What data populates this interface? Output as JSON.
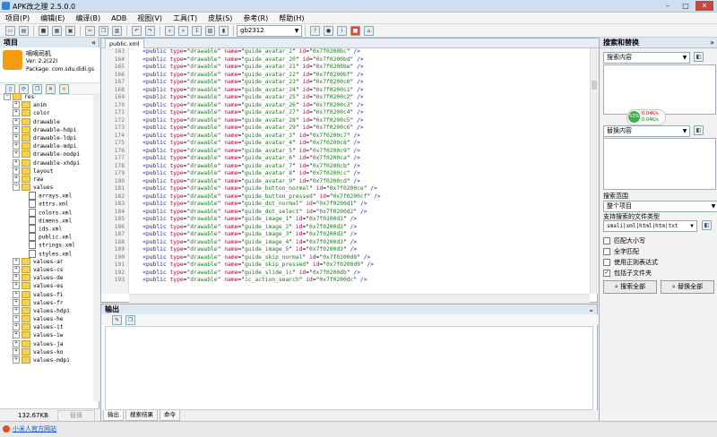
{
  "window": {
    "title": "APK改之理 2.5.0.0",
    "min": "–",
    "max": "□",
    "close": "✕"
  },
  "menu": [
    "项目(P)",
    "编辑(E)",
    "编译(B)",
    "ADB",
    "视图(V)",
    "工具(T)",
    "皮肤(S)",
    "参考(R)",
    "帮助(H)"
  ],
  "toolbar": {
    "encoding": "gb2312"
  },
  "project_panel": {
    "title": "项目",
    "app": {
      "name": "嘀嘀司机",
      "version": "Ver: 2.2(22)",
      "package": "Package: com.sdu.didi.gs"
    },
    "tree": [
      {
        "label": "res",
        "depth": 0,
        "kind": "folder",
        "exp": "−"
      },
      {
        "label": "anim",
        "depth": 1,
        "kind": "folder",
        "exp": "+"
      },
      {
        "label": "color",
        "depth": 1,
        "kind": "folder",
        "exp": "+"
      },
      {
        "label": "drawable",
        "depth": 1,
        "kind": "folder",
        "exp": "+"
      },
      {
        "label": "drawable-hdpi",
        "depth": 1,
        "kind": "folder",
        "exp": "+"
      },
      {
        "label": "drawable-ldpi",
        "depth": 1,
        "kind": "folder",
        "exp": "+"
      },
      {
        "label": "drawable-mdpi",
        "depth": 1,
        "kind": "folder",
        "exp": "+"
      },
      {
        "label": "drawable-nodpi",
        "depth": 1,
        "kind": "folder",
        "exp": "+"
      },
      {
        "label": "drawable-xhdpi",
        "depth": 1,
        "kind": "folder",
        "exp": "+"
      },
      {
        "label": "layout",
        "depth": 1,
        "kind": "folder",
        "exp": "+"
      },
      {
        "label": "raw",
        "depth": 1,
        "kind": "folder",
        "exp": "+"
      },
      {
        "label": "values",
        "depth": 1,
        "kind": "folder",
        "exp": "−"
      },
      {
        "label": "arrays.xml",
        "depth": 2,
        "kind": "file"
      },
      {
        "label": "attrs.xml",
        "depth": 2,
        "kind": "file"
      },
      {
        "label": "colors.xml",
        "depth": 2,
        "kind": "file"
      },
      {
        "label": "dimens.xml",
        "depth": 2,
        "kind": "file"
      },
      {
        "label": "ids.xml",
        "depth": 2,
        "kind": "file"
      },
      {
        "label": "public.xml",
        "depth": 2,
        "kind": "file"
      },
      {
        "label": "strings.xml",
        "depth": 2,
        "kind": "file"
      },
      {
        "label": "styles.xml",
        "depth": 2,
        "kind": "file"
      },
      {
        "label": "values-ar",
        "depth": 1,
        "kind": "folder",
        "exp": "+"
      },
      {
        "label": "values-cs",
        "depth": 1,
        "kind": "folder",
        "exp": "+"
      },
      {
        "label": "values-de",
        "depth": 1,
        "kind": "folder",
        "exp": "+"
      },
      {
        "label": "values-es",
        "depth": 1,
        "kind": "folder",
        "exp": "+"
      },
      {
        "label": "values-fi",
        "depth": 1,
        "kind": "folder",
        "exp": "+"
      },
      {
        "label": "values-fr",
        "depth": 1,
        "kind": "folder",
        "exp": "+"
      },
      {
        "label": "values-hdpi",
        "depth": 1,
        "kind": "folder",
        "exp": "+"
      },
      {
        "label": "values-he",
        "depth": 1,
        "kind": "folder",
        "exp": "+"
      },
      {
        "label": "values-it",
        "depth": 1,
        "kind": "folder",
        "exp": "+"
      },
      {
        "label": "values-iw",
        "depth": 1,
        "kind": "folder",
        "exp": "+"
      },
      {
        "label": "values-ja",
        "depth": 1,
        "kind": "folder",
        "exp": "+"
      },
      {
        "label": "values-ko",
        "depth": 1,
        "kind": "folder",
        "exp": "+"
      },
      {
        "label": "values-mdpi",
        "depth": 1,
        "kind": "folder",
        "exp": "+"
      }
    ],
    "size": "132.67KB",
    "replace_button": "替换"
  },
  "editor": {
    "tab": "public.xml",
    "lines": [
      {
        "num": "163",
        "name": "guide_avatar_2",
        "id": "0x7f0200bc"
      },
      {
        "num": "164",
        "name": "guide_avatar_20",
        "id": "0x7f0200bd"
      },
      {
        "num": "165",
        "name": "guide_avatar_21",
        "id": "0x7f0200be"
      },
      {
        "num": "166",
        "name": "guide_avatar_22",
        "id": "0x7f0200bf"
      },
      {
        "num": "167",
        "name": "guide_avatar_23",
        "id": "0x7f0200c0"
      },
      {
        "num": "168",
        "name": "guide_avatar_24",
        "id": "0x7f0200c1"
      },
      {
        "num": "169",
        "name": "guide_avatar_25",
        "id": "0x7f0200c2"
      },
      {
        "num": "170",
        "name": "guide_avatar_26",
        "id": "0x7f0200c3"
      },
      {
        "num": "171",
        "name": "guide_avatar_27",
        "id": "0x7f0200c4"
      },
      {
        "num": "172",
        "name": "guide_avatar_28",
        "id": "0x7f0200c5"
      },
      {
        "num": "173",
        "name": "guide_avatar_29",
        "id": "0x7f0200c6"
      },
      {
        "num": "174",
        "name": "guide_avatar_3",
        "id": "0x7f0200c7"
      },
      {
        "num": "175",
        "name": "guide_avatar_4",
        "id": "0x7f0200c8"
      },
      {
        "num": "176",
        "name": "guide_avatar_5",
        "id": "0x7f0200c9"
      },
      {
        "num": "177",
        "name": "guide_avatar_6",
        "id": "0x7f0200ca"
      },
      {
        "num": "178",
        "name": "guide_avatar_7",
        "id": "0x7f0200cb"
      },
      {
        "num": "179",
        "name": "guide_avatar_8",
        "id": "0x7f0200cc"
      },
      {
        "num": "180",
        "name": "guide_avatar_9",
        "id": "0x7f0200cd"
      },
      {
        "num": "181",
        "name": "guide_button_normal",
        "id": "0x7f0200ce"
      },
      {
        "num": "182",
        "name": "guide_button_pressed",
        "id": "0x7f0200cf"
      },
      {
        "num": "183",
        "name": "guide_dot_normal",
        "id": "0x7f0200d1"
      },
      {
        "num": "184",
        "name": "guide_dot_select",
        "id": "0x7f0200d2"
      },
      {
        "num": "185",
        "name": "guide_image_1",
        "id": "0x7f0200d3"
      },
      {
        "num": "186",
        "name": "guide_image_2",
        "id": "0x7f0200d3"
      },
      {
        "num": "187",
        "name": "guide_image_3",
        "id": "0x7f0200d3"
      },
      {
        "num": "188",
        "name": "guide_image_4",
        "id": "0x7f0200d3"
      },
      {
        "num": "189",
        "name": "guide_image_5",
        "id": "0x7f0200d3"
      },
      {
        "num": "190",
        "name": "guide_skip_normal",
        "id": "0x7f0200d8"
      },
      {
        "num": "191",
        "name": "guide_skip_pressed",
        "id": "0x7f0200d9"
      },
      {
        "num": "192",
        "name": "guide_slide_ic",
        "id": "0x7f0200db"
      },
      {
        "num": "193",
        "name": "ic_action_search",
        "id": "0x7f0200dc"
      }
    ],
    "type_value": "drawable"
  },
  "output": {
    "title": "输出",
    "tabs": [
      "输出",
      "搜索结果",
      "命令"
    ]
  },
  "search_panel": {
    "title": "搜索和替换",
    "search_combo": "搜索内容",
    "replace_combo": "替换内容",
    "speed_percent": "53%",
    "speed_up": "0.04K/s",
    "speed_down": "0.04K/s",
    "scope_label": "搜索范围",
    "scope_value": "整个项目",
    "filetypes_label": "支持搜索的文件类型",
    "filetypes_value": "smali|xml|html|htm|txt",
    "options": [
      {
        "label": "匹配大小写",
        "checked": false
      },
      {
        "label": "全字匹配",
        "checked": false
      },
      {
        "label": "使用正则表达式",
        "checked": false
      },
      {
        "label": "包括子文件夹",
        "checked": true
      }
    ],
    "search_all": "搜索全部",
    "replace_all": "替换全部"
  },
  "statusbar": {
    "link": "小米人官方网站"
  }
}
